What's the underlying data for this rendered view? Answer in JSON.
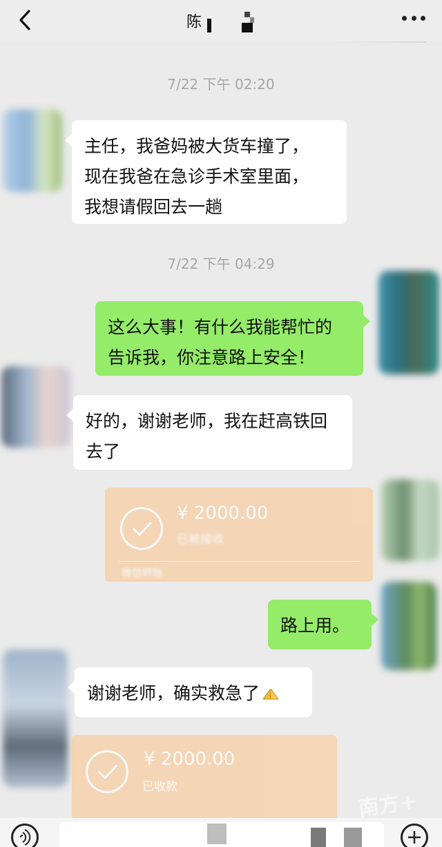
{
  "header": {
    "title": "陈",
    "back_icon": "chevron-left-icon",
    "more_icon": "more-dots-icon"
  },
  "messages": [
    {
      "type": "timestamp",
      "text": "7/22 下午 02:20"
    },
    {
      "type": "text",
      "side": "left",
      "lines": [
        "主任，我爸妈被大货车撞了，",
        "现在我爸在急诊手术室里面，",
        "我想请假回去一趟"
      ]
    },
    {
      "type": "timestamp",
      "text": "7/22 下午 04:29"
    },
    {
      "type": "text",
      "side": "right",
      "lines": [
        "这么大事！有什么我能帮忙的",
        "告诉我，你注意路上安全！"
      ]
    },
    {
      "type": "text",
      "side": "left",
      "lines": [
        "好的，谢谢老师，我在赶高铁回",
        "去了"
      ]
    },
    {
      "type": "transfer",
      "side": "right",
      "amount": "¥ 2000.00",
      "status": "已被接收",
      "footer": "微信转账"
    },
    {
      "type": "text",
      "side": "right",
      "lines": [
        "路上用。"
      ]
    },
    {
      "type": "text",
      "side": "left",
      "lines": [
        "谢谢老师，确实救急了"
      ],
      "emoji": "folded-hands-emoji"
    },
    {
      "type": "transfer",
      "side": "left",
      "amount": "¥ 2000.00",
      "status": "已收款"
    }
  ],
  "watermark": "南方+",
  "colors": {
    "background": "#ebebeb",
    "bubble_self": "#95ec69",
    "bubble_other": "#ffffff",
    "transfer": "#f7cfa6",
    "timestamp": "#a6a6a6"
  },
  "bottombar": {
    "voice_icon": "voice-icon",
    "plus_icon": "plus-icon"
  }
}
